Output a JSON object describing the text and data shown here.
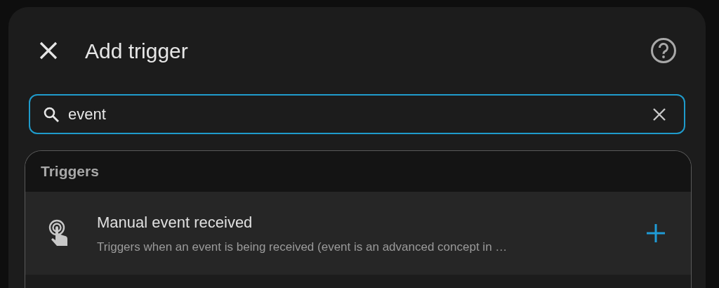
{
  "dialog": {
    "title": "Add trigger"
  },
  "search": {
    "value": "event"
  },
  "section": {
    "title": "Triggers",
    "items": [
      {
        "title": "Manual event received",
        "description": "Triggers when an event is being received (event is an advanced concept in …"
      }
    ]
  }
}
